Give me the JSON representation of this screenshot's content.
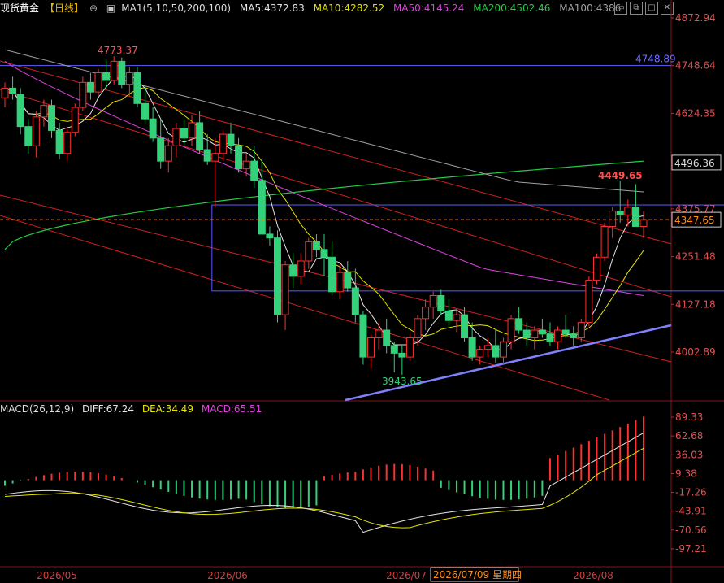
{
  "header": {
    "symbol": "现货黄金",
    "period": "【日线】",
    "ma_label": "MA1(5,10,50,200,100)",
    "ma5": "MA5:4372.83",
    "ma10": "MA10:4282.52",
    "ma50": "MA50:4145.24",
    "ma200": "MA200:4502.46",
    "ma100": "MA100:4386",
    "colors": {
      "ma5": "#e6e6e6",
      "ma10": "#e6e600",
      "ma50": "#e040e0",
      "ma200": "#22cc44",
      "ma100": "#a0a0a0"
    },
    "icons": [
      "window-icon",
      "restore-icon",
      "maximize-icon",
      "close-icon"
    ]
  },
  "macd_header": {
    "label": "MACD(26,12,9)",
    "diff": "DIFF:67.24",
    "dea": "DEA:34.49",
    "macd": "MACD:65.51"
  },
  "chart_data": [
    {
      "type": "candlestick",
      "series_name": "现货黄金",
      "ylim": [
        3943.65,
        4872.94
      ],
      "y_ticks": [
        "4872.94",
        "4748.64",
        "4624.35",
        "4500.06",
        "4375.77",
        "4251.48",
        "4127.18",
        "4002.89"
      ],
      "x_ticks": [
        "2026/05",
        "2026/06",
        "2026/07",
        "2026/08"
      ],
      "cursor_date": "2026/07/09 星期四",
      "annotations": {
        "high_label": "4773.37",
        "low_label": "3943.65",
        "recent_high_label": "4449.65",
        "hline_label": "4748.89",
        "level_label": "4496.36",
        "last_price_label": "4347.65"
      },
      "hline_value": 4748.89,
      "last_price": 4347.65,
      "box": {
        "top": 4386,
        "bottom": 4162,
        "start_index": 27,
        "end_index": 130
      },
      "ohlc": [
        [
          4665,
          4705,
          4640,
          4690
        ],
        [
          4690,
          4720,
          4660,
          4675
        ],
        [
          4675,
          4690,
          4570,
          4590
        ],
        [
          4590,
          4610,
          4520,
          4540
        ],
        [
          4540,
          4630,
          4510,
          4615
        ],
        [
          4615,
          4660,
          4590,
          4645
        ],
        [
          4645,
          4660,
          4560,
          4580
        ],
        [
          4580,
          4600,
          4505,
          4520
        ],
        [
          4520,
          4585,
          4500,
          4575
        ],
        [
          4575,
          4650,
          4565,
          4640
        ],
        [
          4640,
          4720,
          4630,
          4705
        ],
        [
          4705,
          4730,
          4660,
          4680
        ],
        [
          4680,
          4740,
          4670,
          4730
        ],
        [
          4730,
          4765,
          4690,
          4710
        ],
        [
          4710,
          4773,
          4700,
          4760
        ],
        [
          4760,
          4770,
          4690,
          4700
        ],
        [
          4700,
          4745,
          4670,
          4730
        ],
        [
          4730,
          4745,
          4640,
          4650
        ],
        [
          4650,
          4690,
          4600,
          4610
        ],
        [
          4610,
          4640,
          4550,
          4560
        ],
        [
          4560,
          4610,
          4480,
          4500
        ],
        [
          4500,
          4560,
          4470,
          4540
        ],
        [
          4540,
          4600,
          4510,
          4585
        ],
        [
          4585,
          4610,
          4540,
          4560
        ],
        [
          4560,
          4620,
          4540,
          4600
        ],
        [
          4600,
          4630,
          4520,
          4530
        ],
        [
          4530,
          4570,
          4490,
          4500
        ],
        [
          4500,
          4560,
          4380,
          4520
        ],
        [
          4520,
          4580,
          4500,
          4570
        ],
        [
          4570,
          4600,
          4520,
          4540
        ],
        [
          4540,
          4560,
          4470,
          4480
        ],
        [
          4480,
          4520,
          4460,
          4500
        ],
        [
          4500,
          4540,
          4430,
          4450
        ],
        [
          4450,
          4500,
          4380,
          4310
        ],
        [
          4310,
          4330,
          4280,
          4300
        ],
        [
          4300,
          4320,
          4080,
          4100
        ],
        [
          4100,
          4240,
          4060,
          4230
        ],
        [
          4230,
          4260,
          4170,
          4200
        ],
        [
          4200,
          4260,
          4180,
          4240
        ],
        [
          4240,
          4300,
          4220,
          4290
        ],
        [
          4290,
          4310,
          4250,
          4270
        ],
        [
          4270,
          4310,
          4200,
          4250
        ],
        [
          4250,
          4290,
          4150,
          4160
        ],
        [
          4160,
          4230,
          4140,
          4210
        ],
        [
          4210,
          4240,
          4160,
          4170
        ],
        [
          4170,
          4220,
          4080,
          4100
        ],
        [
          4100,
          4110,
          3970,
          3990
        ],
        [
          3990,
          4050,
          3960,
          4040
        ],
        [
          4040,
          4080,
          4010,
          4060
        ],
        [
          4060,
          4090,
          4000,
          4020
        ],
        [
          4020,
          4030,
          3950,
          4000
        ],
        [
          4000,
          4020,
          3943.65,
          3990
        ],
        [
          3990,
          4050,
          3980,
          4040
        ],
        [
          4040,
          4100,
          4020,
          4090
        ],
        [
          4090,
          4140,
          4060,
          4120
        ],
        [
          4120,
          4160,
          4090,
          4150
        ],
        [
          4150,
          4165,
          4100,
          4110
        ],
        [
          4110,
          4140,
          4070,
          4085
        ],
        [
          4085,
          4110,
          4055,
          4100
        ],
        [
          4100,
          4120,
          4030,
          4040
        ],
        [
          4040,
          4080,
          3980,
          3990
        ],
        [
          3990,
          4020,
          3970,
          4010
        ],
        [
          4010,
          4040,
          3990,
          4020
        ],
        [
          4020,
          4060,
          3975,
          3990
        ],
        [
          3990,
          4040,
          3970,
          4030
        ],
        [
          4030,
          4100,
          4010,
          4090
        ],
        [
          4090,
          4120,
          4050,
          4060
        ],
        [
          4060,
          4080,
          4020,
          4040
        ],
        [
          4040,
          4070,
          4010,
          4060
        ],
        [
          4060,
          4090,
          4040,
          4050
        ],
        [
          4050,
          4080,
          4020,
          4030
        ],
        [
          4030,
          4070,
          4010,
          4060
        ],
        [
          4060,
          4100,
          4040,
          4050
        ],
        [
          4050,
          4070,
          4020,
          4040
        ],
        [
          4040,
          4090,
          4030,
          4080
        ],
        [
          4080,
          4200,
          4070,
          4190
        ],
        [
          4190,
          4260,
          4180,
          4250
        ],
        [
          4250,
          4340,
          4240,
          4330
        ],
        [
          4330,
          4380,
          4300,
          4370
        ],
        [
          4370,
          4449.65,
          4340,
          4360
        ],
        [
          4360,
          4400,
          4330,
          4380
        ],
        [
          4380,
          4440,
          4350,
          4330
        ],
        [
          4330,
          4370,
          4300,
          4347.65
        ]
      ]
    },
    {
      "type": "bar+line",
      "series_name": "MACD",
      "ylim": [
        -97.21,
        89.33
      ],
      "y_ticks": [
        "89.33",
        "62.68",
        "36.03",
        "9.38",
        "-17.26",
        "-43.91",
        "-70.56",
        "-97.21"
      ],
      "series": [
        {
          "name": "DIFF",
          "color": "#e6e6e6"
        },
        {
          "name": "DEA",
          "color": "#e6e600"
        },
        {
          "name": "MACD",
          "color": "#e040e0"
        }
      ]
    }
  ]
}
